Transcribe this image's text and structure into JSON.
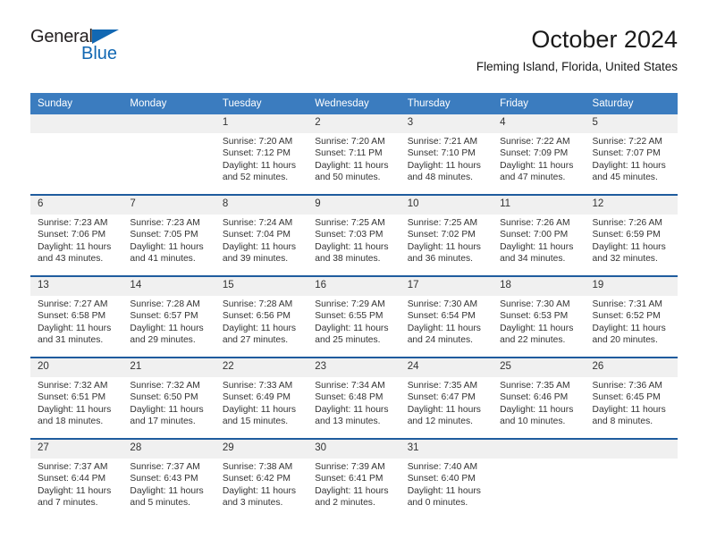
{
  "logo": {
    "word1": "General",
    "word2": "Blue",
    "triangle_color": "#1268b3",
    "word1_color": "#231f20",
    "word2_color": "#1268b3"
  },
  "header": {
    "title": "October 2024",
    "subtitle": "Fleming Island, Florida, United States"
  },
  "theme": {
    "header_bg": "#3b7cbf",
    "header_text": "#ffffff",
    "row_divider": "#1f5c9e",
    "daynum_bg": "#f0f0f0",
    "body_text": "#333333"
  },
  "calendar": {
    "weekday_headers": [
      "Sunday",
      "Monday",
      "Tuesday",
      "Wednesday",
      "Thursday",
      "Friday",
      "Saturday"
    ],
    "weeks": [
      [
        {
          "day": "",
          "sunrise": "",
          "sunset": "",
          "daylight": "",
          "empty": true
        },
        {
          "day": "",
          "sunrise": "",
          "sunset": "",
          "daylight": "",
          "empty": true
        },
        {
          "day": "1",
          "sunrise": "Sunrise: 7:20 AM",
          "sunset": "Sunset: 7:12 PM",
          "daylight": "Daylight: 11 hours and 52 minutes."
        },
        {
          "day": "2",
          "sunrise": "Sunrise: 7:20 AM",
          "sunset": "Sunset: 7:11 PM",
          "daylight": "Daylight: 11 hours and 50 minutes."
        },
        {
          "day": "3",
          "sunrise": "Sunrise: 7:21 AM",
          "sunset": "Sunset: 7:10 PM",
          "daylight": "Daylight: 11 hours and 48 minutes."
        },
        {
          "day": "4",
          "sunrise": "Sunrise: 7:22 AM",
          "sunset": "Sunset: 7:09 PM",
          "daylight": "Daylight: 11 hours and 47 minutes."
        },
        {
          "day": "5",
          "sunrise": "Sunrise: 7:22 AM",
          "sunset": "Sunset: 7:07 PM",
          "daylight": "Daylight: 11 hours and 45 minutes."
        }
      ],
      [
        {
          "day": "6",
          "sunrise": "Sunrise: 7:23 AM",
          "sunset": "Sunset: 7:06 PM",
          "daylight": "Daylight: 11 hours and 43 minutes."
        },
        {
          "day": "7",
          "sunrise": "Sunrise: 7:23 AM",
          "sunset": "Sunset: 7:05 PM",
          "daylight": "Daylight: 11 hours and 41 minutes."
        },
        {
          "day": "8",
          "sunrise": "Sunrise: 7:24 AM",
          "sunset": "Sunset: 7:04 PM",
          "daylight": "Daylight: 11 hours and 39 minutes."
        },
        {
          "day": "9",
          "sunrise": "Sunrise: 7:25 AM",
          "sunset": "Sunset: 7:03 PM",
          "daylight": "Daylight: 11 hours and 38 minutes."
        },
        {
          "day": "10",
          "sunrise": "Sunrise: 7:25 AM",
          "sunset": "Sunset: 7:02 PM",
          "daylight": "Daylight: 11 hours and 36 minutes."
        },
        {
          "day": "11",
          "sunrise": "Sunrise: 7:26 AM",
          "sunset": "Sunset: 7:00 PM",
          "daylight": "Daylight: 11 hours and 34 minutes."
        },
        {
          "day": "12",
          "sunrise": "Sunrise: 7:26 AM",
          "sunset": "Sunset: 6:59 PM",
          "daylight": "Daylight: 11 hours and 32 minutes."
        }
      ],
      [
        {
          "day": "13",
          "sunrise": "Sunrise: 7:27 AM",
          "sunset": "Sunset: 6:58 PM",
          "daylight": "Daylight: 11 hours and 31 minutes."
        },
        {
          "day": "14",
          "sunrise": "Sunrise: 7:28 AM",
          "sunset": "Sunset: 6:57 PM",
          "daylight": "Daylight: 11 hours and 29 minutes."
        },
        {
          "day": "15",
          "sunrise": "Sunrise: 7:28 AM",
          "sunset": "Sunset: 6:56 PM",
          "daylight": "Daylight: 11 hours and 27 minutes."
        },
        {
          "day": "16",
          "sunrise": "Sunrise: 7:29 AM",
          "sunset": "Sunset: 6:55 PM",
          "daylight": "Daylight: 11 hours and 25 minutes."
        },
        {
          "day": "17",
          "sunrise": "Sunrise: 7:30 AM",
          "sunset": "Sunset: 6:54 PM",
          "daylight": "Daylight: 11 hours and 24 minutes."
        },
        {
          "day": "18",
          "sunrise": "Sunrise: 7:30 AM",
          "sunset": "Sunset: 6:53 PM",
          "daylight": "Daylight: 11 hours and 22 minutes."
        },
        {
          "day": "19",
          "sunrise": "Sunrise: 7:31 AM",
          "sunset": "Sunset: 6:52 PM",
          "daylight": "Daylight: 11 hours and 20 minutes."
        }
      ],
      [
        {
          "day": "20",
          "sunrise": "Sunrise: 7:32 AM",
          "sunset": "Sunset: 6:51 PM",
          "daylight": "Daylight: 11 hours and 18 minutes."
        },
        {
          "day": "21",
          "sunrise": "Sunrise: 7:32 AM",
          "sunset": "Sunset: 6:50 PM",
          "daylight": "Daylight: 11 hours and 17 minutes."
        },
        {
          "day": "22",
          "sunrise": "Sunrise: 7:33 AM",
          "sunset": "Sunset: 6:49 PM",
          "daylight": "Daylight: 11 hours and 15 minutes."
        },
        {
          "day": "23",
          "sunrise": "Sunrise: 7:34 AM",
          "sunset": "Sunset: 6:48 PM",
          "daylight": "Daylight: 11 hours and 13 minutes."
        },
        {
          "day": "24",
          "sunrise": "Sunrise: 7:35 AM",
          "sunset": "Sunset: 6:47 PM",
          "daylight": "Daylight: 11 hours and 12 minutes."
        },
        {
          "day": "25",
          "sunrise": "Sunrise: 7:35 AM",
          "sunset": "Sunset: 6:46 PM",
          "daylight": "Daylight: 11 hours and 10 minutes."
        },
        {
          "day": "26",
          "sunrise": "Sunrise: 7:36 AM",
          "sunset": "Sunset: 6:45 PM",
          "daylight": "Daylight: 11 hours and 8 minutes."
        }
      ],
      [
        {
          "day": "27",
          "sunrise": "Sunrise: 7:37 AM",
          "sunset": "Sunset: 6:44 PM",
          "daylight": "Daylight: 11 hours and 7 minutes."
        },
        {
          "day": "28",
          "sunrise": "Sunrise: 7:37 AM",
          "sunset": "Sunset: 6:43 PM",
          "daylight": "Daylight: 11 hours and 5 minutes."
        },
        {
          "day": "29",
          "sunrise": "Sunrise: 7:38 AM",
          "sunset": "Sunset: 6:42 PM",
          "daylight": "Daylight: 11 hours and 3 minutes."
        },
        {
          "day": "30",
          "sunrise": "Sunrise: 7:39 AM",
          "sunset": "Sunset: 6:41 PM",
          "daylight": "Daylight: 11 hours and 2 minutes."
        },
        {
          "day": "31",
          "sunrise": "Sunrise: 7:40 AM",
          "sunset": "Sunset: 6:40 PM",
          "daylight": "Daylight: 11 hours and 0 minutes."
        },
        {
          "day": "",
          "sunrise": "",
          "sunset": "",
          "daylight": "",
          "empty": true
        },
        {
          "day": "",
          "sunrise": "",
          "sunset": "",
          "daylight": "",
          "empty": true
        }
      ]
    ]
  }
}
